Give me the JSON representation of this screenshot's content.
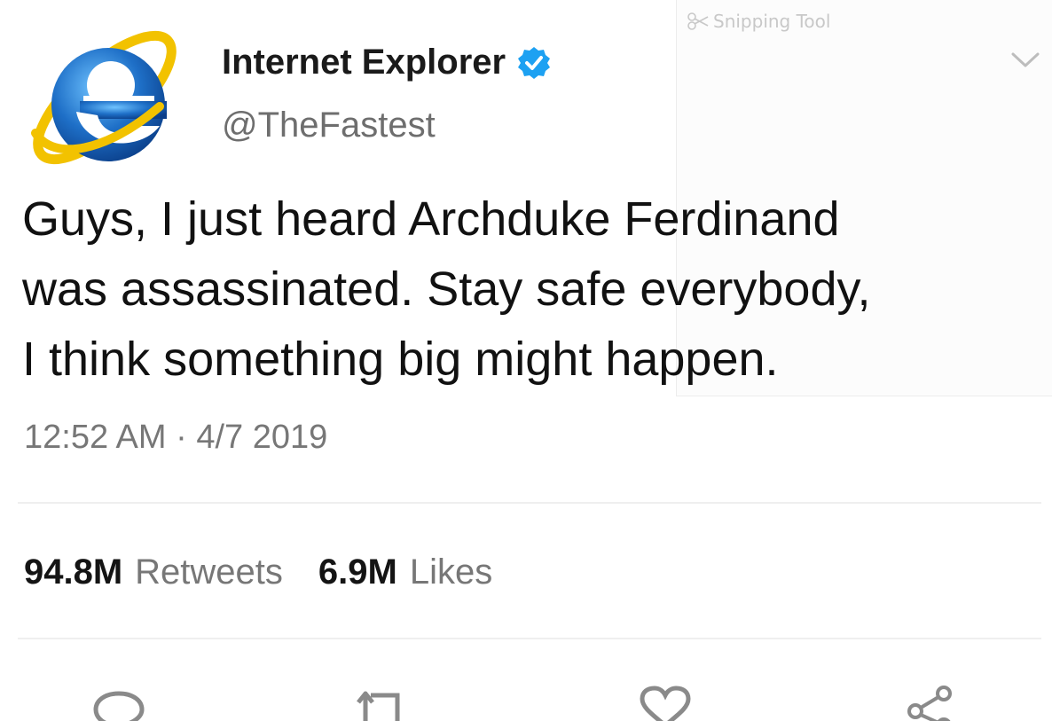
{
  "overlay": {
    "snipping_tool_label": "Snipping Tool",
    "snipping_icon": "scissors-icon"
  },
  "tweet": {
    "display_name": "Internet Explorer",
    "verified_icon": "verified-badge-icon",
    "handle": "@TheFastest",
    "text_lines": [
      "Guys, I just heard Archduke Ferdinand",
      "was assassinated. Stay safe everybody,",
      "I think something big might happen."
    ],
    "timestamp": "12:52 AM · 4/7 2019",
    "stats": {
      "retweets_count": "94.8M",
      "retweets_label": "Retweets",
      "likes_count": "6.9M",
      "likes_label": "Likes"
    },
    "actions": [
      "reply-icon",
      "retweet-icon",
      "like-icon",
      "share-icon"
    ]
  },
  "colors": {
    "verified_blue": "#1da1f2",
    "ie_blue": "#1e6fc7",
    "ie_gold": "#f2c200"
  }
}
